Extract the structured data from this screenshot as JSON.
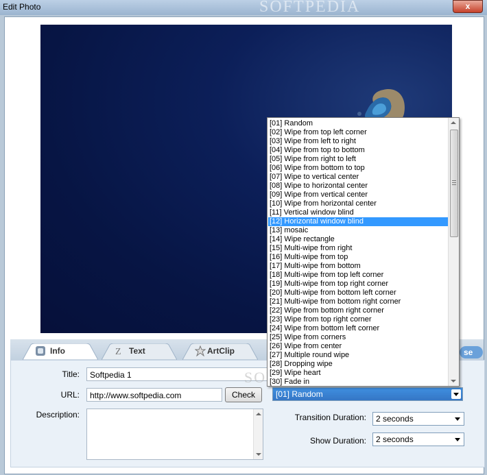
{
  "window": {
    "title": "Edit Photo",
    "close_label": "x",
    "watermark": "SOFTPEDIA"
  },
  "tabs": [
    {
      "label": "Info",
      "icon": "info-icon"
    },
    {
      "label": "Text",
      "icon": "text-icon"
    },
    {
      "label": "ArtClip",
      "icon": "artclip-icon"
    }
  ],
  "close_tab_partial": "se",
  "form": {
    "title_label": "Title:",
    "title_value": "Softpedia 1",
    "url_label": "URL:",
    "url_value": "http://www.softpedia.com",
    "check_button": "Check",
    "description_label": "Description:",
    "description_value": "",
    "transition_selected": "[01] Random",
    "transition_duration_label": "Transition Duration:",
    "transition_duration_value": "2 seconds",
    "show_duration_label": "Show Duration:",
    "show_duration_value": "2 seconds"
  },
  "transitions": [
    "[01] Random",
    "[02] Wipe from top left corner",
    "[03] Wipe from left to right",
    "[04] Wipe from top to bottom",
    "[05] Wipe from right to left",
    "[06] Wipe from bottom to top",
    "[07] Wipe to vertical center",
    "[08] Wipe to horizontal center",
    "[09] Wipe from vertical center",
    "[10] Wipe from horizontal center",
    "[11] Vertical window blind",
    "[12] Horizontal window blind",
    "[13] mosaic",
    "[14] Wipe rectangle",
    "[15] Multi-wipe from right",
    "[16] Multi-wipe from top",
    "[17] Multi-wipe from bottom",
    "[18] Multi-wipe from top left corner",
    "[19] Multi-wipe from top right corner",
    "[20] Multi-wipe from bottom left corner",
    "[21] Multi-wipe from bottom right corner",
    "[22] Wipe from bottom right corner",
    "[23] Wipe from top right corner",
    "[24] Wipe from bottom left corner",
    "[25] Wipe from corners",
    "[26] Wipe from center",
    "[27] Multiple round wipe",
    "[28] Dropping wipe",
    "[29] Wipe heart",
    "[30] Fade in"
  ],
  "highlighted_index": 11,
  "colors": {
    "highlight": "#3399ff",
    "preview_bg": "#0c1f59",
    "close_button": "#c7422b"
  }
}
